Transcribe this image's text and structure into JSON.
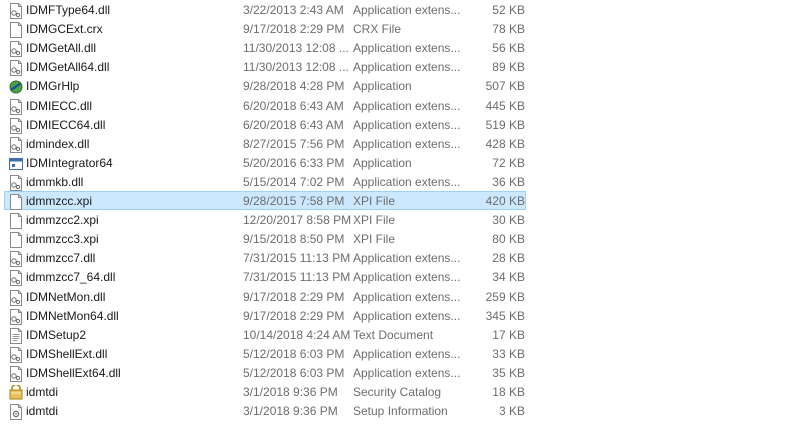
{
  "files": [
    {
      "name": "IDMFType64.dll",
      "date": "3/22/2013 2:43 AM",
      "type": "Application extens...",
      "size": "52 KB",
      "icon": "dll-icon"
    },
    {
      "name": "IDMGCExt.crx",
      "date": "9/17/2018 2:29 PM",
      "type": "CRX File",
      "size": "78 KB",
      "icon": "file-icon"
    },
    {
      "name": "IDMGetAll.dll",
      "date": "11/30/2013 12:08 ...",
      "type": "Application extens...",
      "size": "56 KB",
      "icon": "dll-icon"
    },
    {
      "name": "IDMGetAll64.dll",
      "date": "11/30/2013 12:08 ...",
      "type": "Application extens...",
      "size": "89 KB",
      "icon": "dll-icon"
    },
    {
      "name": "IDMGrHlp",
      "date": "9/28/2018 4:28 PM",
      "type": "Application",
      "size": "507 KB",
      "icon": "grhlp-app-icon"
    },
    {
      "name": "IDMIECC.dll",
      "date": "6/20/2018 6:43 AM",
      "type": "Application extens...",
      "size": "445 KB",
      "icon": "dll-icon"
    },
    {
      "name": "IDMIECC64.dll",
      "date": "6/20/2018 6:43 AM",
      "type": "Application extens...",
      "size": "519 KB",
      "icon": "dll-icon"
    },
    {
      "name": "idmindex.dll",
      "date": "8/27/2015 7:56 PM",
      "type": "Application extens...",
      "size": "428 KB",
      "icon": "dll-icon"
    },
    {
      "name": "IDMIntegrator64",
      "date": "5/20/2016 6:33 PM",
      "type": "Application",
      "size": "72 KB",
      "icon": "app-window-icon"
    },
    {
      "name": "idmmkb.dll",
      "date": "5/15/2014 7:02 PM",
      "type": "Application extens...",
      "size": "36 KB",
      "icon": "dll-icon"
    },
    {
      "name": "idmmzcc.xpi",
      "date": "9/28/2015 7:58 PM",
      "type": "XPI File",
      "size": "420 KB",
      "icon": "file-icon",
      "selected": true
    },
    {
      "name": "idmmzcc2.xpi",
      "date": "12/20/2017 8:58 PM",
      "type": "XPI File",
      "size": "30 KB",
      "icon": "file-icon"
    },
    {
      "name": "idmmzcc3.xpi",
      "date": "9/15/2018 8:50 PM",
      "type": "XPI File",
      "size": "80 KB",
      "icon": "file-icon"
    },
    {
      "name": "idmmzcc7.dll",
      "date": "7/31/2015 11:13 PM",
      "type": "Application extens...",
      "size": "28 KB",
      "icon": "dll-icon"
    },
    {
      "name": "idmmzcc7_64.dll",
      "date": "7/31/2015 11:13 PM",
      "type": "Application extens...",
      "size": "34 KB",
      "icon": "dll-icon"
    },
    {
      "name": "IDMNetMon.dll",
      "date": "9/17/2018 2:29 PM",
      "type": "Application extens...",
      "size": "259 KB",
      "icon": "dll-icon"
    },
    {
      "name": "IDMNetMon64.dll",
      "date": "9/17/2018 2:29 PM",
      "type": "Application extens...",
      "size": "345 KB",
      "icon": "dll-icon"
    },
    {
      "name": "IDMSetup2",
      "date": "10/14/2018 4:24 AM",
      "type": "Text Document",
      "size": "17 KB",
      "icon": "text-document-icon"
    },
    {
      "name": "IDMShellExt.dll",
      "date": "5/12/2018 6:03 PM",
      "type": "Application extens...",
      "size": "33 KB",
      "icon": "dll-icon"
    },
    {
      "name": "IDMShellExt64.dll",
      "date": "5/12/2018 6:03 PM",
      "type": "Application extens...",
      "size": "35 KB",
      "icon": "dll-icon"
    },
    {
      "name": "idmtdi",
      "date": "3/1/2018 9:36 PM",
      "type": "Security Catalog",
      "size": "18 KB",
      "icon": "security-catalog-icon"
    },
    {
      "name": "idmtdi",
      "date": "3/1/2018 9:36 PM",
      "type": "Setup Information",
      "size": "3 KB",
      "icon": "setup-information-icon"
    }
  ],
  "colors": {
    "selection_background": "#cce8ff",
    "selection_border": "#99d1ff",
    "detail_text": "#6d6d6d"
  }
}
